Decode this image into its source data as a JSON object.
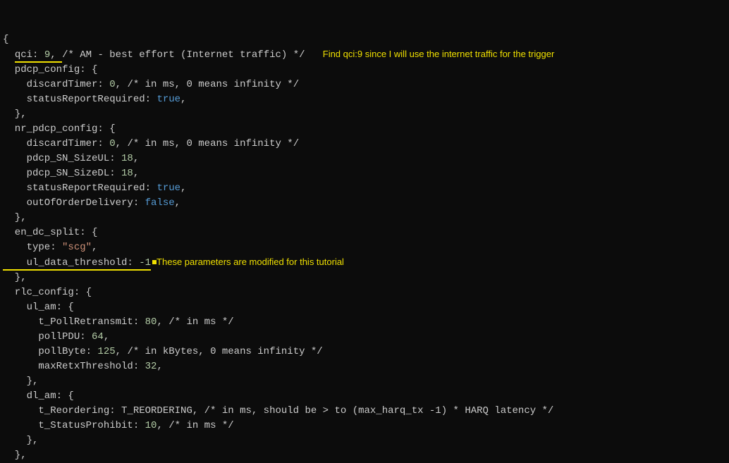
{
  "annotations": {
    "a1": "Find qci:9 since I will use the internet traffic for the trigger",
    "a2": "These parameters are modified for this tutorial"
  },
  "code": {
    "l01a": "{",
    "l02_indent": "  ",
    "l02_key": "qci",
    "l02_colon": ": ",
    "l02_val": "9",
    "l02_comma": ", ",
    "l02_comment": "/* AM - best effort (Internet traffic) */",
    "l03": "  pdcp_config: {",
    "l04a": "    discardTimer: ",
    "l04b": "0",
    "l04c": ", ",
    "l04d": "/* in ms, 0 means infinity */",
    "l05a": "    statusReportRequired: ",
    "l05b": "true",
    "l05c": ",",
    "l06": "  },",
    "l07": "  nr_pdcp_config: {",
    "l08a": "    discardTimer: ",
    "l08b": "0",
    "l08c": ", ",
    "l08d": "/* in ms, 0 means infinity */",
    "l09a": "    pdcp_SN_SizeUL: ",
    "l09b": "18",
    "l09c": ",",
    "l10a": "    pdcp_SN_SizeDL: ",
    "l10b": "18",
    "l10c": ",",
    "l11a": "    statusReportRequired: ",
    "l11b": "true",
    "l11c": ",",
    "l12a": "    outOfOrderDelivery: ",
    "l12b": "false",
    "l12c": ",",
    "l13": "  },",
    "l14": "  en_dc_split: {",
    "l15a": "    type: ",
    "l15b": "\"scg\"",
    "l15c": ",",
    "l16a": "    ul_data_threshold: ",
    "l16b": "-1",
    "l17": "  },",
    "l18": "  rlc_config: {",
    "l19": "    ul_am: {",
    "l20a": "      t_PollRetransmit: ",
    "l20b": "80",
    "l20c": ", ",
    "l20d": "/* in ms */",
    "l21a": "      pollPDU: ",
    "l21b": "64",
    "l21c": ",",
    "l22a": "      pollByte: ",
    "l22b": "125",
    "l22c": ", ",
    "l22d": "/* in kBytes, 0 means infinity */",
    "l23a": "      maxRetxThreshold: ",
    "l23b": "32",
    "l23c": ",",
    "l24": "    },",
    "l25": "    dl_am: {",
    "l26a": "      t_Reordering: T_REORDERING, ",
    "l26b": "/* in ms, should be > to (max_harq_tx -1) * HARQ latency */",
    "l27a": "      t_StatusProhibit: ",
    "l27b": "10",
    "l27c": ", ",
    "l27d": "/* in ms */",
    "l28": "    },",
    "l29": "  },"
  }
}
